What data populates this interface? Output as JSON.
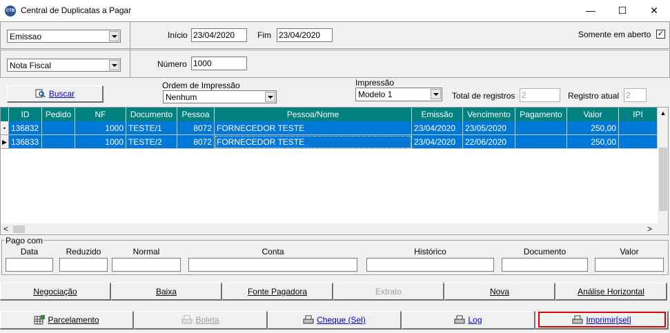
{
  "window": {
    "title": "Central de Duplicatas a Pagar",
    "icon_text": "CTB",
    "minimize": "—",
    "maximize": "☐",
    "close": "✕"
  },
  "filters": {
    "date_type": "Emissao",
    "inicio_label": "Início",
    "inicio_value": "23/04/2020",
    "fim_label": "Fim",
    "fim_value": "23/04/2020",
    "somente_label": "Somente em aberto",
    "somente_checked": "✓",
    "doc_type": "Nota Fiscal",
    "numero_label": "Número",
    "numero_value": "1000"
  },
  "toolbar": {
    "buscar_label": "Buscar",
    "ordem_label": "Ordem de Impressão",
    "ordem_value": "Nenhum",
    "impressao_label": "Impressão",
    "impressao_value": "Modelo 1",
    "total_label": "Total de registros",
    "total_value": "2",
    "registro_label": "Registro atual",
    "registro_value": "2"
  },
  "grid": {
    "columns": [
      "ID",
      "Pedido",
      "NF",
      "Documento",
      "Pessoa",
      "Pessoa/Nome",
      "Emissão",
      "Vencimento",
      "Pagamento",
      "Valor",
      "IPI"
    ],
    "rows": [
      {
        "indicator": "•",
        "id": "136832",
        "pedido": "",
        "nf": "1000",
        "documento": "TESTE/1",
        "pessoa": "8072",
        "nome": "FORNECEDOR TESTE",
        "emissao": "23/04/2020",
        "vencimento": "23/05/2020",
        "pagamento": "",
        "valor": "250,00",
        "ipi": ""
      },
      {
        "indicator": "▶",
        "id": "136833",
        "pedido": "",
        "nf": "1000",
        "documento": "TESTE/2",
        "pessoa": "8072",
        "nome": "FORNECEDOR TESTE",
        "emissao": "23/04/2020",
        "vencimento": "22/06/2020",
        "pagamento": "",
        "valor": "250,00",
        "ipi": ""
      }
    ],
    "scroll_left": "<",
    "scroll_right": ">"
  },
  "pago_com": {
    "title": "Pago com",
    "columns": [
      "Data",
      "Reduzido",
      "Normal",
      "Conta",
      "Histórico",
      "Documento",
      "Valor"
    ]
  },
  "actions_row1": [
    {
      "label": "Negociação",
      "disabled": false
    },
    {
      "label": "Baixa",
      "disabled": false
    },
    {
      "label": "Fonte Pagadora",
      "disabled": false
    },
    {
      "label": "Extrato",
      "disabled": true
    },
    {
      "label": "Nova",
      "disabled": false
    },
    {
      "label": "Análise Horizontal",
      "disabled": false
    }
  ],
  "actions_row2": [
    {
      "label": "Parcelamento",
      "disabled": false,
      "blue": false,
      "icon": "grid-plus-icon"
    },
    {
      "label": "Boleta",
      "disabled": true,
      "blue": false,
      "icon": "printer-icon"
    },
    {
      "label": "Cheque (Sel)",
      "disabled": false,
      "blue": true,
      "icon": "printer-icon"
    },
    {
      "label": "Log",
      "disabled": false,
      "blue": true,
      "icon": "printer-icon"
    },
    {
      "label": "Imprimir[sel]",
      "disabled": false,
      "blue": true,
      "icon": "printer-icon"
    }
  ],
  "colors": {
    "header_bg": "#008080",
    "selection_bg": "#0078d7",
    "highlight_border": "#e00000"
  }
}
